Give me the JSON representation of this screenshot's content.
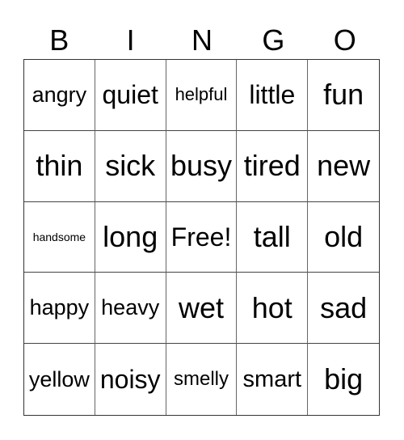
{
  "header": [
    "B",
    "I",
    "N",
    "G",
    "O"
  ],
  "rows": [
    [
      {
        "text": "angry",
        "size": "md"
      },
      {
        "text": "quiet",
        "size": "lg"
      },
      {
        "text": "helpful",
        "size": "sm"
      },
      {
        "text": "little",
        "size": "lg"
      },
      {
        "text": "fun",
        "size": "xl"
      }
    ],
    [
      {
        "text": "thin",
        "size": "xl"
      },
      {
        "text": "sick",
        "size": "xl"
      },
      {
        "text": "busy",
        "size": "xl"
      },
      {
        "text": "tired",
        "size": "xl"
      },
      {
        "text": "new",
        "size": "xl"
      }
    ],
    [
      {
        "text": "handsome",
        "size": "xs"
      },
      {
        "text": "long",
        "size": "xl"
      },
      {
        "text": "Free!",
        "size": "lg"
      },
      {
        "text": "tall",
        "size": "xl"
      },
      {
        "text": "old",
        "size": "xl"
      }
    ],
    [
      {
        "text": "happy",
        "size": "md"
      },
      {
        "text": "heavy",
        "size": "md"
      },
      {
        "text": "wet",
        "size": "xl"
      },
      {
        "text": "hot",
        "size": "xl"
      },
      {
        "text": "sad",
        "size": "xl"
      }
    ],
    [
      {
        "text": "yellow",
        "size": "md"
      },
      {
        "text": "noisy",
        "size": "lg"
      },
      {
        "text": "smelly",
        "size": "sm2"
      },
      {
        "text": "smart",
        "size": "md2"
      },
      {
        "text": "big",
        "size": "xl"
      }
    ]
  ]
}
